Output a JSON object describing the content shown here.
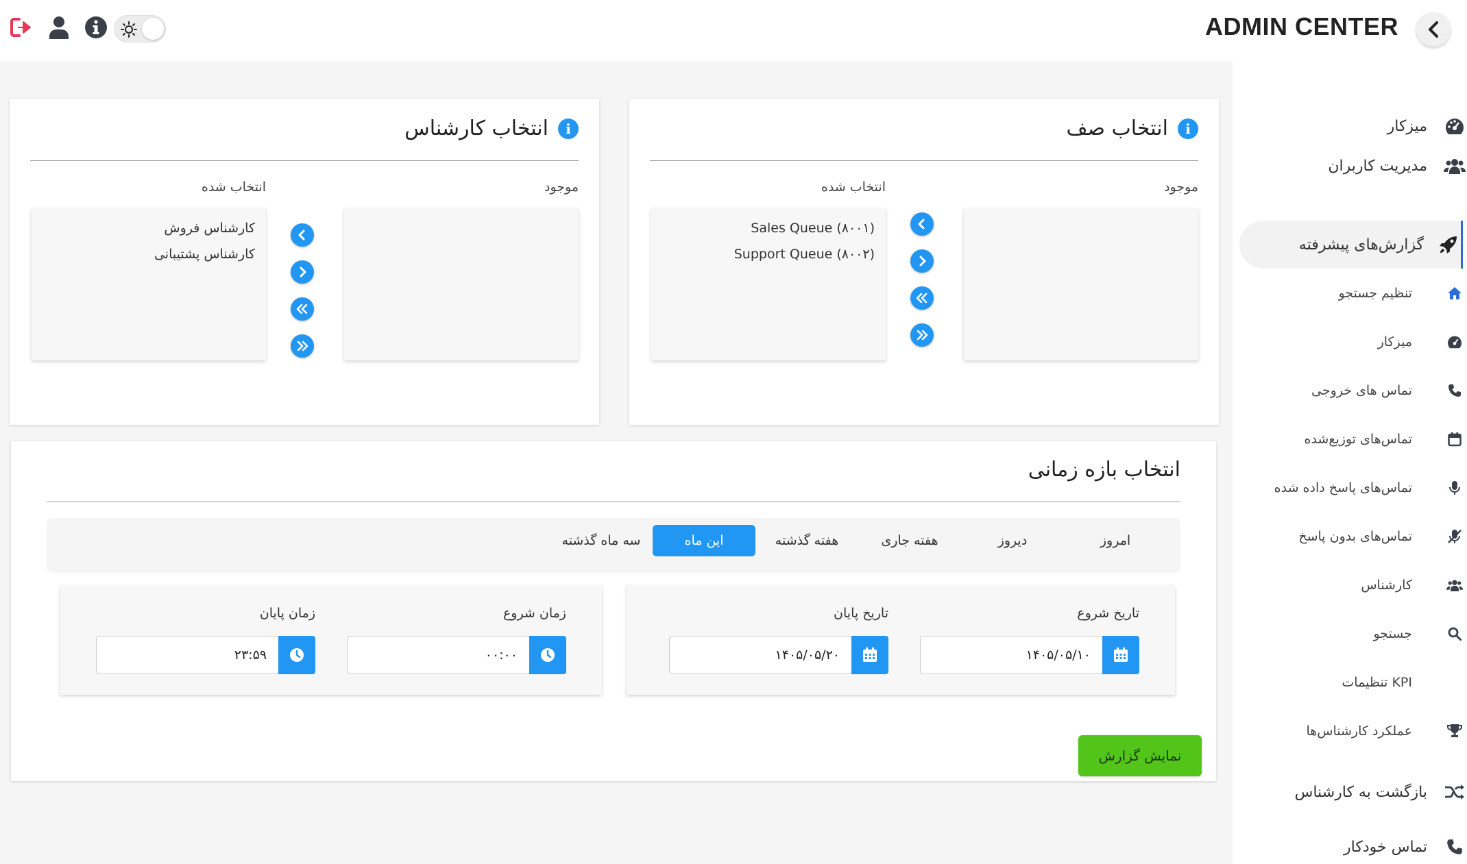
{
  "header": {
    "brand": "ADMIN CENTER",
    "icons": [
      "logout-icon",
      "user-icon",
      "info-icon",
      "theme-toggle",
      "chevron-left-icon"
    ]
  },
  "sidebar": {
    "items": [
      {
        "label": "میزکار",
        "icon": "dashboard-icon"
      },
      {
        "label": "مدیریت کاربران",
        "icon": "users-icon"
      },
      {
        "label": "گزارش‌های پیشرفته",
        "icon": "rocket-icon"
      },
      {
        "label": "تنظیم جستجو",
        "icon": "home-icon"
      },
      {
        "label": "میزکار",
        "icon": "dashboard-icon"
      },
      {
        "label": "تماس های خروجی",
        "icon": "phone-icon"
      },
      {
        "label": "تماس‌های توزیع‌شده",
        "icon": "calendar-icon"
      },
      {
        "label": "تماس‌های پاسخ داده شده",
        "icon": "mic-icon"
      },
      {
        "label": "تماس‌های بدون پاسخ",
        "icon": "mic-off-icon"
      },
      {
        "label": "کارشناس",
        "icon": "users-icon"
      },
      {
        "label": "جستجو",
        "icon": "search-icon"
      },
      {
        "label": "تنظیمات KPI",
        "icon": "none"
      },
      {
        "label": "عملکرد کارشناس‌ها",
        "icon": "trophy-icon"
      },
      {
        "label": "بازگشت به کارشناس",
        "icon": "shuffle-icon"
      },
      {
        "label": "تماس خودکار",
        "icon": "phone-icon"
      }
    ]
  },
  "queue_card": {
    "title": "انتخاب صف",
    "available_label": "موجود",
    "selected_label": "انتخاب شده",
    "selected_items": [
      "Sales Queue (۸۰۰۱)",
      "Support Queue (۸۰۰۲)"
    ]
  },
  "agent_card": {
    "title": "انتخاب کارشناس",
    "available_label": "موجود",
    "selected_label": "انتخاب شده",
    "selected_items": [
      "کارشناس فروش",
      "کارشناس پشتیبانی"
    ]
  },
  "range_card": {
    "title": "انتخاب بازه زمانی",
    "presets": [
      "امروز",
      "دیروز",
      "هفته جاری",
      "هفته گذشته",
      "این ماه",
      "سه ماه گذشته"
    ],
    "selected_preset": "این ماه",
    "date": {
      "start_label": "تاریخ شروع",
      "start_value": "۱۴۰۵/۰۵/۱۰",
      "end_label": "تاریخ پایان",
      "end_value": "۱۴۰۵/۰۵/۲۰"
    },
    "time": {
      "start_label": "زمان شروع",
      "start_value": "۰۰:۰۰",
      "end_label": "زمان پایان",
      "end_value": "۲۳:۵۹"
    }
  },
  "report_button": "نمایش گزارش",
  "colors": {
    "accent": "#2196f3",
    "success": "#52c41a",
    "logout": "#e53957"
  }
}
